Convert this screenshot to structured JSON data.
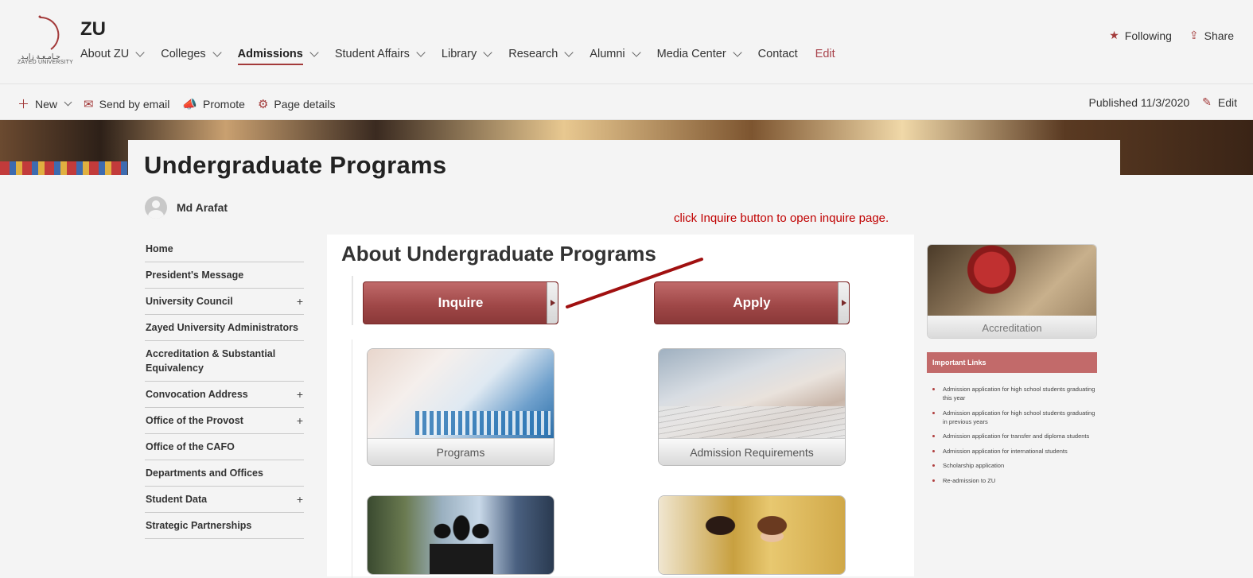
{
  "site": {
    "title": "ZU",
    "logo_text": "ZAYED UNIVERSITY",
    "logo_arabic": "جـامـعـة زايـد"
  },
  "topnav": {
    "items": [
      {
        "label": "About ZU",
        "dropdown": true
      },
      {
        "label": "Colleges",
        "dropdown": true
      },
      {
        "label": "Admissions",
        "dropdown": true,
        "active": true
      },
      {
        "label": "Student Affairs",
        "dropdown": true
      },
      {
        "label": "Library",
        "dropdown": true
      },
      {
        "label": "Research",
        "dropdown": true
      },
      {
        "label": "Alumni",
        "dropdown": true
      },
      {
        "label": "Media Center",
        "dropdown": true
      },
      {
        "label": "Contact",
        "dropdown": false
      }
    ],
    "edit_label": "Edit"
  },
  "header_actions": {
    "following": "Following",
    "share": "Share"
  },
  "commandbar": {
    "new": "New",
    "send_by_email": "Send by email",
    "promote": "Promote",
    "page_details": "Page details",
    "published": "Published 11/3/2020",
    "edit": "Edit"
  },
  "page": {
    "title": "Undergraduate Programs",
    "author": "Md Arafat"
  },
  "leftnav": {
    "items": [
      {
        "label": "Home",
        "expandable": false
      },
      {
        "label": "President's Message",
        "expandable": false
      },
      {
        "label": "University Council",
        "expandable": true
      },
      {
        "label": "Zayed University Administrators",
        "expandable": false
      },
      {
        "label": "Accreditation & Substantial Equivalency",
        "expandable": false
      },
      {
        "label": "Convocation Address",
        "expandable": true
      },
      {
        "label": "Office of the Provost",
        "expandable": true
      },
      {
        "label": "Office of the CAFO",
        "expandable": false
      },
      {
        "label": "Departments and Offices",
        "expandable": false
      },
      {
        "label": "Student Data",
        "expandable": true
      },
      {
        "label": "Strategic Partnerships",
        "expandable": false
      }
    ]
  },
  "annotation": {
    "text": "click Inquire button to open inquire page."
  },
  "main": {
    "heading": "About Undergraduate Programs",
    "buttons": {
      "inquire": "Inquire",
      "apply": "Apply"
    },
    "tiles": [
      {
        "caption": "Programs"
      },
      {
        "caption": "Admission Requirements"
      }
    ]
  },
  "sidebar": {
    "accreditation_caption": "Accreditation",
    "links_heading": "Important Links",
    "links": [
      "Admission application for high school students graduating this year",
      "Admission application for high school students graduating in previous years",
      "Admission application for transfer and diploma students",
      "Admission application for international students",
      "Scholarship application",
      "Re-admission to ZU"
    ]
  },
  "colors": {
    "accent": "#a33a3a",
    "button": "#a04848",
    "annotation": "#c00000",
    "links_header": "#c26a6a"
  }
}
